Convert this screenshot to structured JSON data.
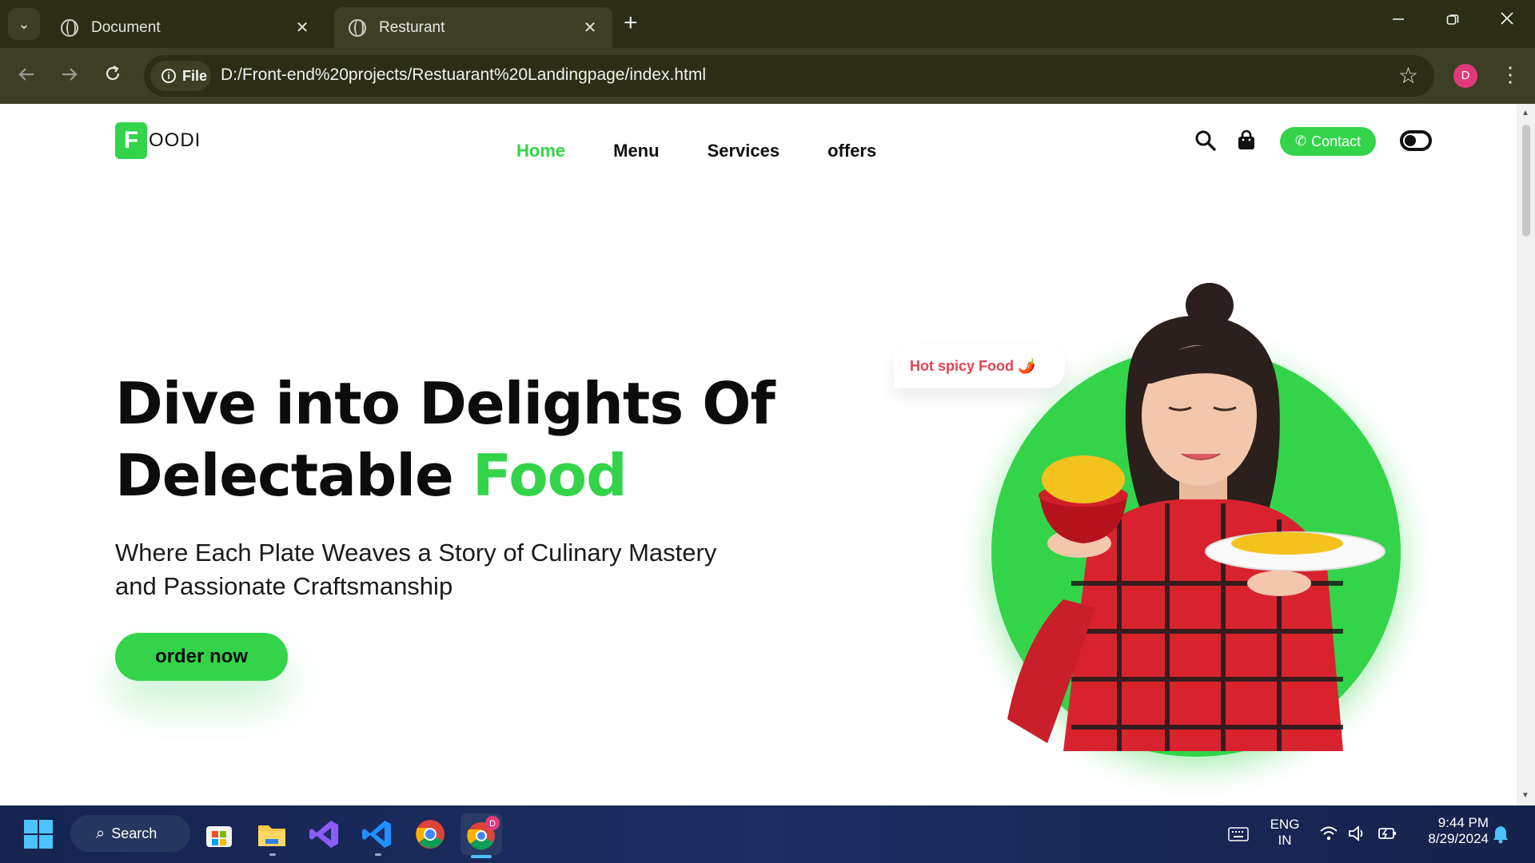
{
  "browser": {
    "tabs": [
      {
        "title": "Document",
        "active": false
      },
      {
        "title": "Resturant",
        "active": true
      }
    ],
    "new_tab_symbol": "+",
    "chip_label": "File",
    "url": "D:/Front-end%20projects/Restuarant%20Landingpage/index.html",
    "profile_initial": "D"
  },
  "site": {
    "logo_mark": "F",
    "logo_rest": "OODI",
    "nav": [
      "Home",
      "Menu",
      "Services",
      "offers"
    ],
    "contact_label": "Contact",
    "hero_title_line1": "Dive into Delights Of",
    "hero_title_line2": "Delectable",
    "hero_title_accent": "Food",
    "hero_subtitle": "Where Each Plate Weaves a Story of Culinary Mastery and Passionate Craftsmanship",
    "order_button": "order now",
    "speech_bubble": "Hot spicy Food 🌶️",
    "accent_color": "#33d44a"
  },
  "taskbar": {
    "search_label": "Search",
    "lang_line1": "ENG",
    "lang_line2": "IN",
    "time": "9:44 PM",
    "date": "8/29/2024"
  }
}
